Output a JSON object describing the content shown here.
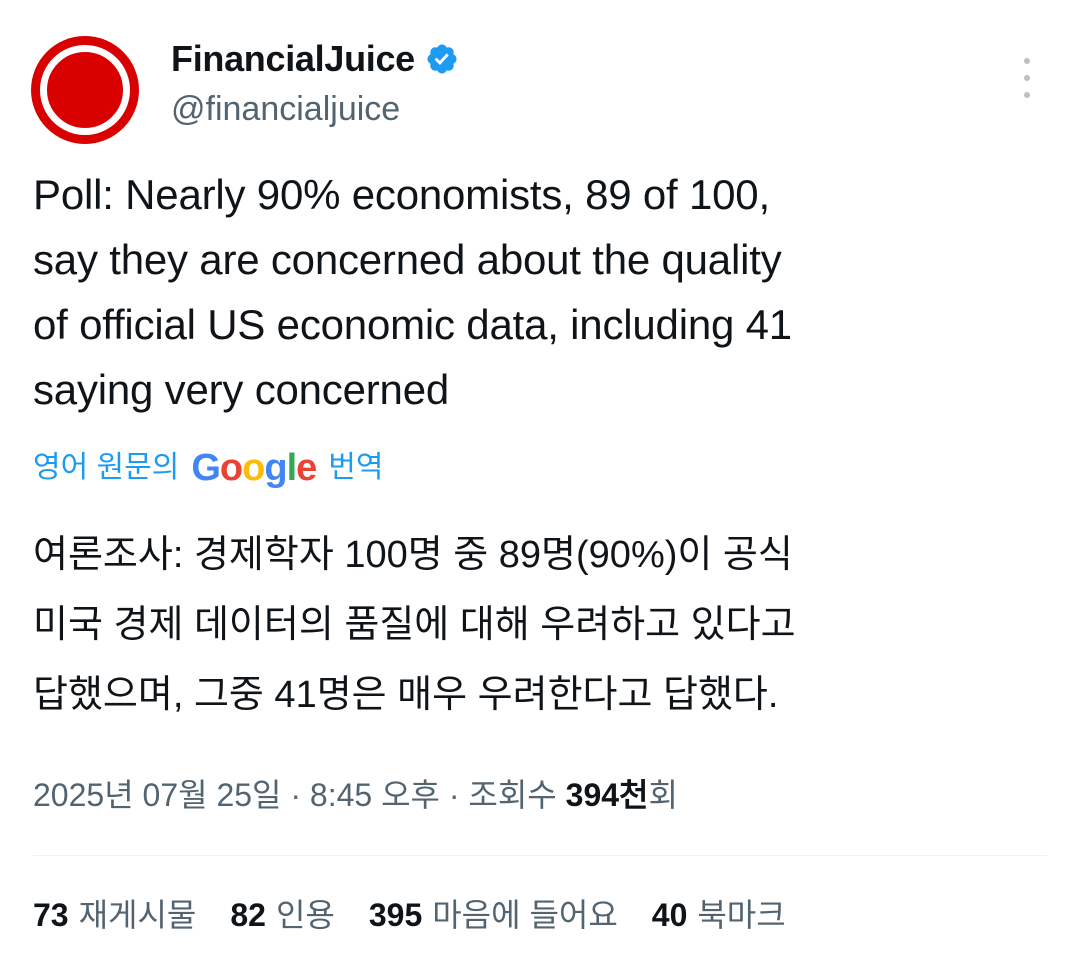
{
  "author": {
    "display_name": "FinancialJuice",
    "handle": "@financialjuice",
    "verified_icon": "verified-badge-icon",
    "avatar_color": "#d90000"
  },
  "tweet": {
    "text": "Poll: Nearly 90% economists, 89 of 100,\nsay they are concerned about the quality\nof official US economic data, including 41\nsaying very concerned"
  },
  "translation": {
    "prefix": "영어 원문의",
    "google": [
      "G",
      "o",
      "o",
      "g",
      "l",
      "e"
    ],
    "suffix": "번역",
    "text": "여론조사: 경제학자 100명 중 89명(90%)이 공식\n미국 경제 데이터의 품질에 대해 우려하고 있다고\n답했으며, 그중 41명은 매우 우려한다고 답했다."
  },
  "meta": {
    "date": "2025년 07월 25일",
    "sep1": " · ",
    "time": "8:45 오후",
    "sep2": " · ",
    "views_label": "조회수 ",
    "views_count": "394천",
    "views_suffix": "회"
  },
  "stats": {
    "reposts": {
      "num": "73",
      "label": "재게시물"
    },
    "quotes": {
      "num": "82",
      "label": "인용"
    },
    "likes": {
      "num": "395",
      "label": "마음에 들어요"
    },
    "bookmarks": {
      "num": "40",
      "label": "북마크"
    }
  },
  "colors": {
    "accent": "#1d9bf0",
    "secondary_text": "#536471",
    "primary_text": "#0f1419"
  }
}
